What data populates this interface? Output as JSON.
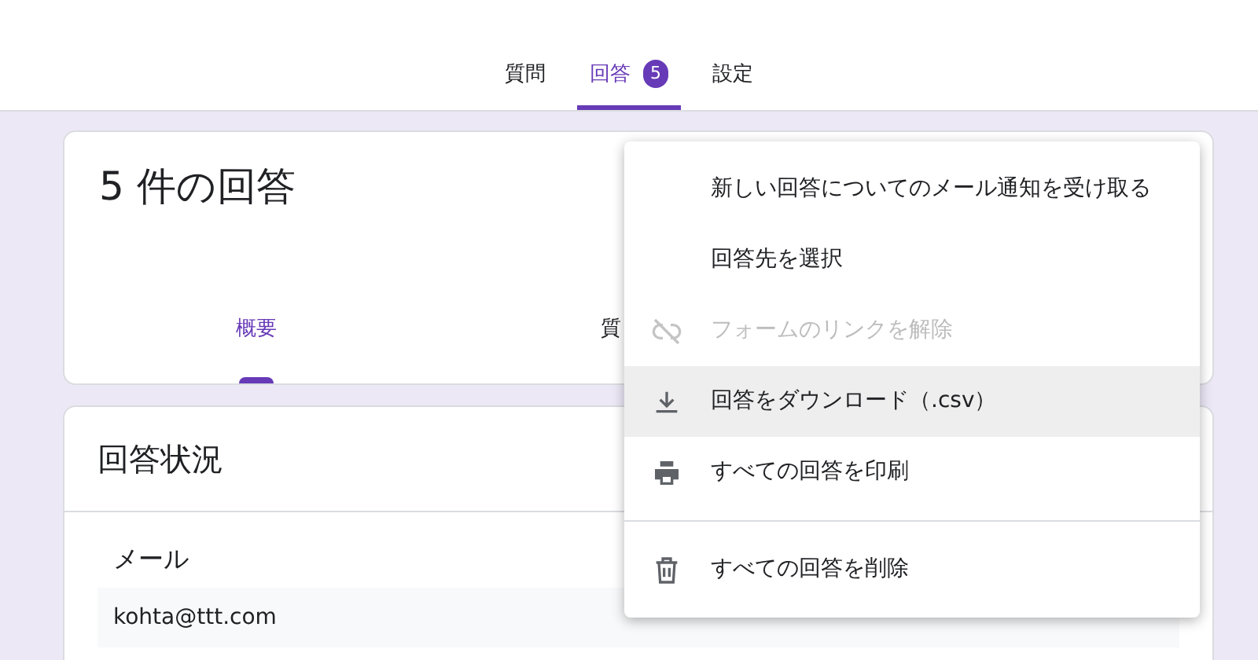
{
  "top_tabs": [
    {
      "label": "質問",
      "selected": false
    },
    {
      "label": "回答",
      "selected": true,
      "badge": "5"
    },
    {
      "label": "設定",
      "selected": false
    }
  ],
  "summary_card": {
    "title": "5 件の回答",
    "tabs": [
      {
        "label": "概要",
        "selected": true
      },
      {
        "label": "質",
        "selected": false
      }
    ]
  },
  "status_card": {
    "title": "回答状況",
    "field_label": "メール",
    "field_value": "kohta@ttt.com"
  },
  "menu": [
    {
      "label": "新しい回答についてのメール通知を受け取る",
      "kind": "none",
      "disabled": false,
      "selected": false
    },
    {
      "label": "回答先を選択",
      "kind": "none",
      "disabled": false,
      "selected": false
    },
    {
      "label": "フォームのリンクを解除",
      "kind": "unlink",
      "disabled": true,
      "selected": false
    },
    {
      "label": "回答をダウンロード（.csv）",
      "kind": "download",
      "disabled": false,
      "selected": true
    },
    {
      "label": "すべての回答を印刷",
      "kind": "print",
      "disabled": false,
      "selected": false
    },
    {
      "label": "すべての回答を削除",
      "kind": "trash",
      "disabled": false,
      "selected": false,
      "divider_before": true
    }
  ]
}
